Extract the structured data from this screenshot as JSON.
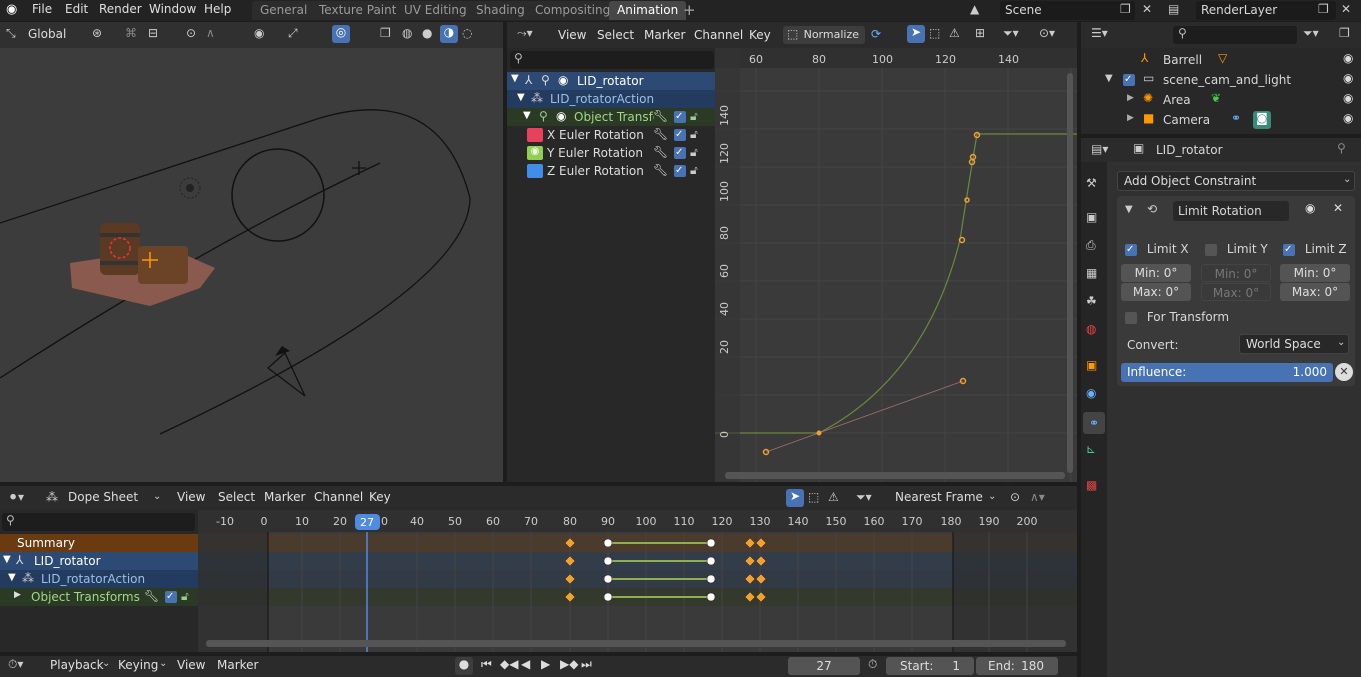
{
  "menus": [
    "File",
    "Edit",
    "Render",
    "Window",
    "Help"
  ],
  "workspaces": [
    "General",
    "Texture Paint",
    "UV Editing",
    "Shading",
    "Compositing",
    "Animation"
  ],
  "active_workspace": "Animation",
  "scene": "Scene",
  "render_layer": "RenderLayer",
  "viewport": {
    "orientation": "Global"
  },
  "graph": {
    "menus": [
      "View",
      "Select",
      "Marker",
      "Channel",
      "Key"
    ],
    "normalize": "Normalize",
    "channels": {
      "object": "LID_rotator",
      "action": "LID_rotatorAction",
      "group": "Object Transforms",
      "curves": [
        "X Euler Rotation",
        "Y Euler Rotation",
        "Z Euler Rotation"
      ]
    },
    "x_ticks": [
      "60",
      "80",
      "100",
      "120",
      "140"
    ],
    "y_ticks": [
      "140",
      "120",
      "100",
      "80",
      "60",
      "40",
      "20",
      "0"
    ]
  },
  "outliner": {
    "items": [
      "Barrell",
      "scene_cam_and_light",
      "Area",
      "Camera"
    ]
  },
  "properties": {
    "object": "LID_rotator",
    "add_constraint": "Add Object Constraint",
    "constraint_name": "Limit Rotation",
    "limit_x": "Limit X",
    "limit_y": "Limit Y",
    "limit_z": "Limit Z",
    "min_x": "Min:  0°",
    "max_x": "Max:  0°",
    "min_y": "Min:  0°",
    "max_y": "Max:  0°",
    "min_z": "Min:  0°",
    "max_z": "Max:  0°",
    "for_transform": "For Transform",
    "convert_label": "Convert:",
    "convert_value": "World Space",
    "influence_label": "Influence:",
    "influence_value": "1.000",
    "influence": 1.0
  },
  "dopesheet": {
    "mode": "Dope Sheet",
    "menus": [
      "View",
      "Select",
      "Marker",
      "Channel",
      "Key"
    ],
    "snap": "Nearest Frame",
    "current_frame": "27",
    "ticks": [
      "-10",
      "0",
      "10",
      "20",
      "27",
      "30",
      "40",
      "50",
      "60",
      "70",
      "80",
      "90",
      "100",
      "110",
      "120",
      "130",
      "140",
      "150",
      "160",
      "170",
      "180",
      "190",
      "200"
    ],
    "rows": [
      "Summary",
      "LID_rotator",
      "LID_rotatorAction",
      "Object Transforms"
    ]
  },
  "timeline": {
    "menus": [
      "Playback",
      "Keying",
      "View",
      "Marker"
    ],
    "frame": "27",
    "start_label": "Start:",
    "start": "1",
    "end_label": "End:",
    "end": "180"
  }
}
